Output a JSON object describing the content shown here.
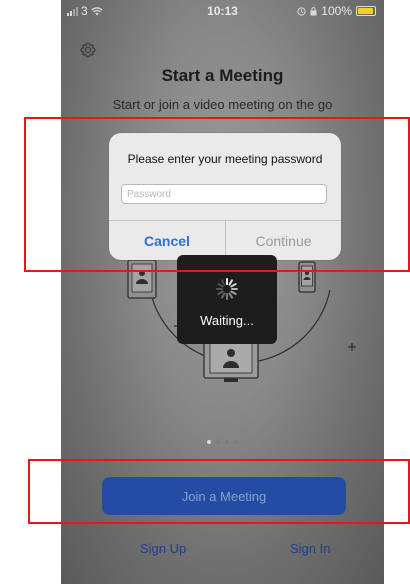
{
  "status_bar": {
    "carrier": "3",
    "time": "10:13",
    "battery": "100%"
  },
  "header": {
    "title": "Start a Meeting",
    "subtitle": "Start or join a video meeting on the go"
  },
  "dialog": {
    "message": "Please enter your meeting password",
    "password_placeholder": "Password",
    "password_value": "",
    "cancel_label": "Cancel",
    "continue_label": "Continue"
  },
  "waiting": {
    "label": "Waiting..."
  },
  "pager": {
    "total": 4,
    "active_index": 0
  },
  "actions": {
    "join_label": "Join a Meeting",
    "sign_up_label": "Sign Up",
    "sign_in_label": "Sign In"
  },
  "icons": {
    "gear": "gear-icon",
    "spinner": "spinner-icon",
    "wifi": "wifi-icon",
    "alarm": "alarm-icon",
    "battery": "battery-icon"
  },
  "colors": {
    "accent_blue": "#2f6fd6",
    "join_button": "#234da4",
    "link_blue": "#1f3f8c",
    "highlight_red": "#e8151b",
    "battery_yellow": "#f3cf24"
  }
}
